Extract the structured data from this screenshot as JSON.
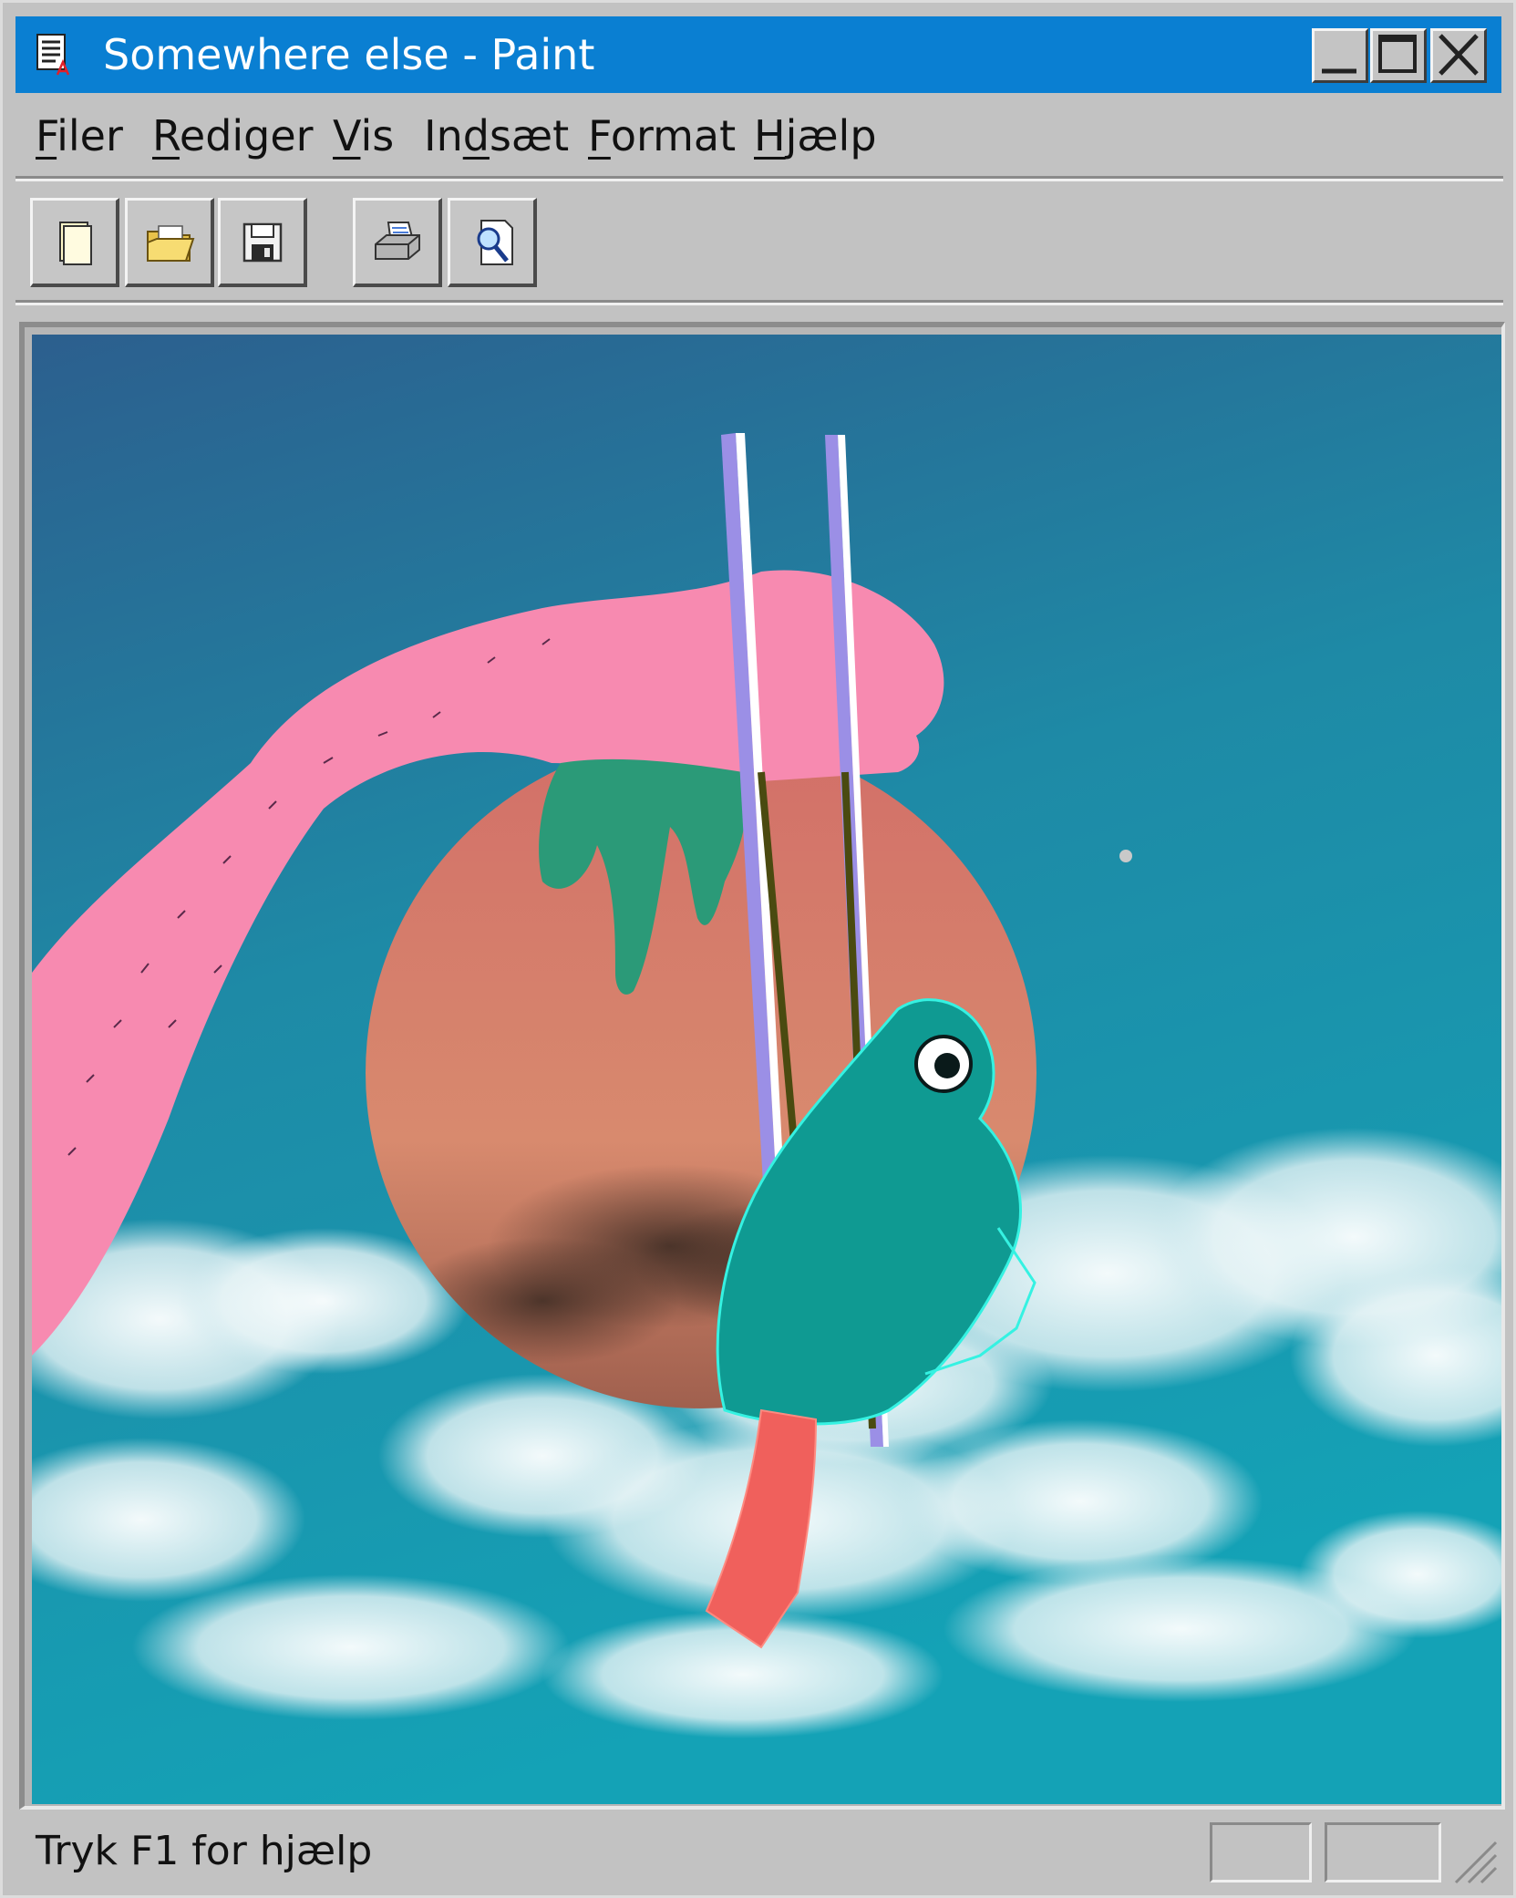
{
  "window": {
    "title": "Somewhere else - Paint",
    "titlebar_color": "#0a7fd2",
    "buttons": [
      "minimize",
      "maximize",
      "close"
    ]
  },
  "menu": {
    "items": [
      {
        "accel": "F",
        "rest": "iler"
      },
      {
        "accel": "R",
        "rest": "ediger"
      },
      {
        "accel": "V",
        "rest": "is"
      },
      {
        "accel": "",
        "prefix": "In",
        "accel_mid": "d",
        "rest": "sæt"
      },
      {
        "accel": "F",
        "rest": "ormat"
      },
      {
        "accel": "H",
        "rest": "jælp"
      }
    ]
  },
  "toolbar": {
    "buttons": [
      "new-document-icon",
      "open-folder-icon",
      "save-disk-icon",
      "print-icon",
      "print-preview-icon"
    ]
  },
  "canvas": {
    "artwork": "collage: pink arm holding chopsticks with a fish in front of an orange sun, blue sky with clouds",
    "colors": {
      "sky_top": "#2c5f8e",
      "sky_bottom": "#1aa0b4",
      "sun": "#d67f6e",
      "arm": "#f78ab0",
      "fish": "#1fd6cc",
      "fish_tail": "#f0605c"
    }
  },
  "status": {
    "text": "Tryk F1 for hjælp"
  }
}
